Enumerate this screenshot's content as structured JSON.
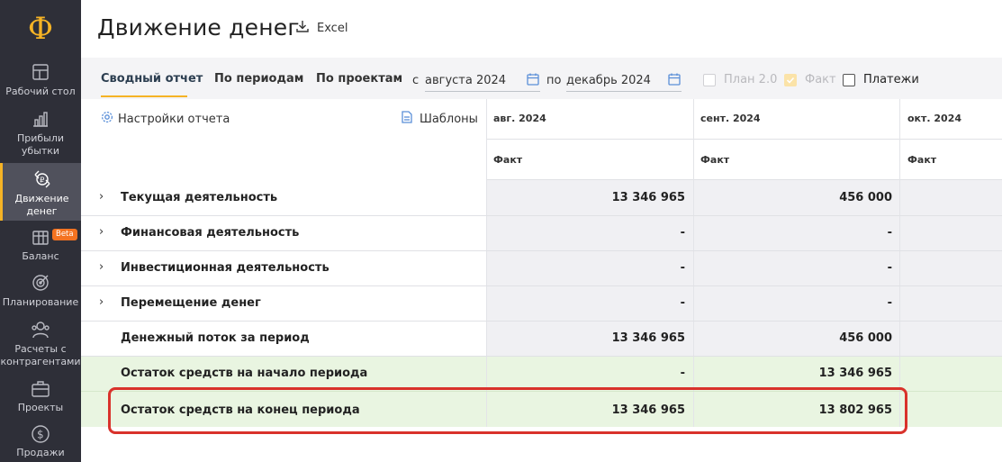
{
  "sidebar": {
    "logo": "Ф",
    "items": [
      {
        "label": "Рабочий стол",
        "icon": "dashboard-icon"
      },
      {
        "label": "Прибыли\nубытки",
        "icon": "bar-chart-icon"
      },
      {
        "label": "Движение\nденег",
        "icon": "money-flow-icon"
      },
      {
        "label": "Баланс",
        "icon": "balance-icon",
        "badge": "Beta"
      },
      {
        "label": "Планирование",
        "icon": "target-icon"
      },
      {
        "label": "Расчеты с\nконтрагентами",
        "icon": "contractors-icon"
      },
      {
        "label": "Проекты",
        "icon": "briefcase-icon"
      },
      {
        "label": "Продажи",
        "icon": "dollar-icon"
      }
    ]
  },
  "header": {
    "title": "Движение денег",
    "excel": "Excel"
  },
  "toolbar": {
    "tabs": [
      "Сводный отчет",
      "По периодам",
      "По проектам"
    ],
    "from_label": "с",
    "from_value": "августа 2024",
    "to_label": "по",
    "to_value": "декабрь 2024",
    "checkboxes": [
      {
        "label": "План 2.0",
        "checked": false,
        "disabled": true
      },
      {
        "label": "Факт",
        "checked": true,
        "disabled": true
      },
      {
        "label": "Платежи",
        "checked": false,
        "disabled": false
      }
    ]
  },
  "table": {
    "settings": "Настройки отчета",
    "templates": "Шаблоны",
    "columns": [
      "авг. 2024",
      "сент. 2024",
      "окт. 2024"
    ],
    "subheads": [
      "Факт",
      "Факт",
      "Факт"
    ],
    "rows": [
      {
        "name": "Текущая деятельность",
        "expandable": true,
        "aug": "13 346 965",
        "sep": "456 000"
      },
      {
        "name": "Финансовая деятельность",
        "expandable": true,
        "aug": "-",
        "sep": "-"
      },
      {
        "name": "Инвестиционная деятельность",
        "expandable": true,
        "aug": "-",
        "sep": "-"
      },
      {
        "name": "Перемещение денег",
        "expandable": true,
        "aug": "-",
        "sep": "-"
      },
      {
        "name": "Денежный поток за период",
        "expandable": false,
        "aug": "13 346 965",
        "sep": "456 000"
      },
      {
        "name": "Остаток средств на начало периода",
        "expandable": false,
        "aug": "-",
        "sep": "13 346 965"
      },
      {
        "name": "Остаток средств на конец периода",
        "expandable": false,
        "aug": "13 346 965",
        "sep": "13 802 965"
      }
    ]
  },
  "colors": {
    "accent": "#f5b325",
    "highlight": "#d9322b",
    "green_row": "#e8f5e0",
    "sidebar": "#2e2f38"
  }
}
